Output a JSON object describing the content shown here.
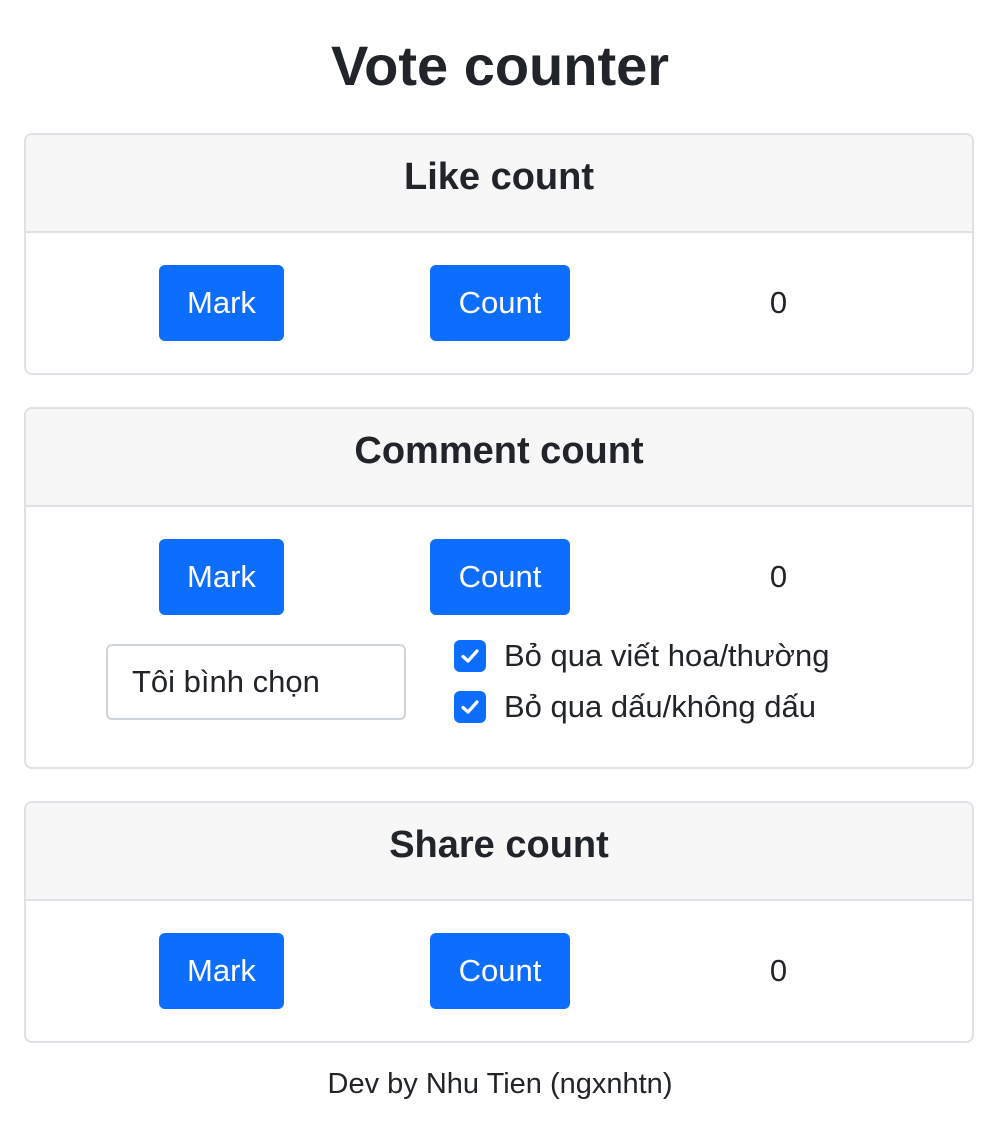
{
  "title": "Vote counter",
  "like": {
    "header": "Like count",
    "mark_label": "Mark",
    "count_label": "Count",
    "count_value": "0"
  },
  "comment": {
    "header": "Comment count",
    "mark_label": "Mark",
    "count_label": "Count",
    "count_value": "0",
    "input_value": "Tôi bình chọn",
    "option_ignore_case": {
      "label": "Bỏ qua viết hoa/thường",
      "checked": true
    },
    "option_ignore_accents": {
      "label": "Bỏ qua dấu/không dấu",
      "checked": true
    }
  },
  "share": {
    "header": "Share count",
    "mark_label": "Mark",
    "count_label": "Count",
    "count_value": "0"
  },
  "footer": "Dev by Nhu Tien (ngxnhtn)",
  "colors": {
    "primary": "#0d6efd",
    "header_bg": "#f7f7f7",
    "border": "#dee2e6"
  },
  "icons": {
    "checkbox_mark": "checkmark-icon"
  }
}
